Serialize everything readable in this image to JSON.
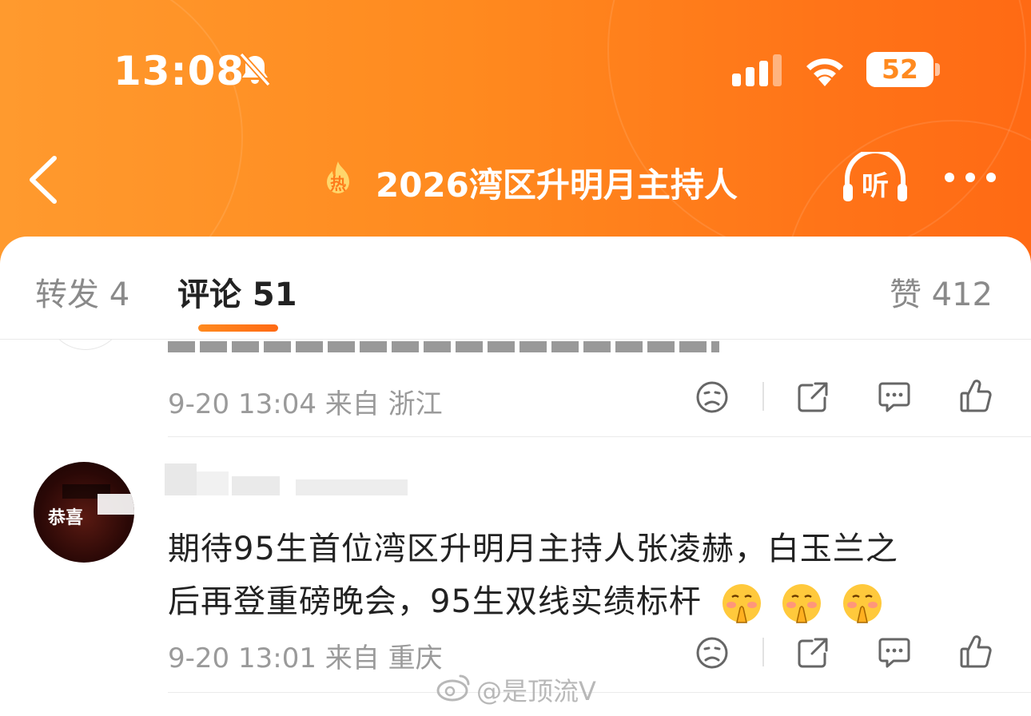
{
  "status_bar": {
    "time": "13:08",
    "battery": "52",
    "battery_level": 0.52
  },
  "nav": {
    "hot_badge": "热",
    "title": "2026湾区升明月主持人",
    "listen_label": "听"
  },
  "tabs": {
    "forward": "转发 4",
    "comments": "评论 51",
    "likes": "赞 412"
  },
  "comments": [
    {
      "meta": "9-20 13:04 来自 浙江"
    },
    {
      "avatar_text": "恭喜",
      "text_line1": "期待95生首位湾区升明月主持人张凌赫，白玉兰之",
      "text_line2": "后再登重磅晚会，95生双线实绩标杆",
      "emojis": [
        "pray-blush-emoji",
        "pray-blush-emoji",
        "pray-blush-emoji"
      ],
      "meta": "9-20 13:01 来自 重庆"
    }
  ],
  "watermark": "@是顶流V",
  "colors": {
    "brand_orange": "#ff8a1f",
    "header_end": "#ff6a14",
    "meta_gray": "#9a9a9a",
    "text": "#222222"
  },
  "icons": {
    "status": [
      "bell-muted-icon",
      "signal-icon",
      "wifi-icon",
      "battery-icon"
    ],
    "nav": [
      "back-icon",
      "hot-flame-icon",
      "listen-headphones-icon",
      "more-icon"
    ],
    "comment_actions": [
      "sad-face-icon",
      "share-icon",
      "comment-icon",
      "thumbs-up-icon"
    ]
  }
}
